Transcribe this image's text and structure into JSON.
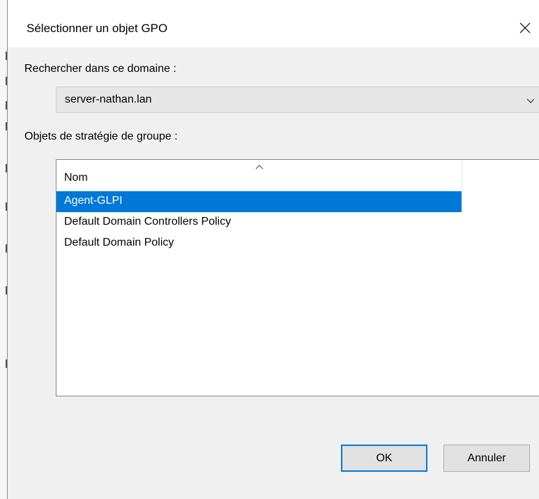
{
  "dialog": {
    "title": "Sélectionner un objet GPO",
    "close_icon": "close-icon"
  },
  "domain": {
    "label": "Rechercher dans ce domaine :",
    "selected": "server-nathan.lan",
    "arrow_icon": "chevron-down-icon"
  },
  "gpo_list": {
    "label": "Objets de stratégie de groupe :",
    "column_header": "Nom",
    "sort_icon": "chevron-up-icon",
    "items": [
      {
        "label": "Agent-GLPI",
        "selected": true
      },
      {
        "label": "Default Domain Controllers Policy",
        "selected": false
      },
      {
        "label": "Default Domain Policy",
        "selected": false
      }
    ]
  },
  "buttons": {
    "ok_label": "OK",
    "cancel_label": "Annuler"
  },
  "colors": {
    "accent": "#0078d7",
    "dialog_background": "#f0f0f0"
  }
}
